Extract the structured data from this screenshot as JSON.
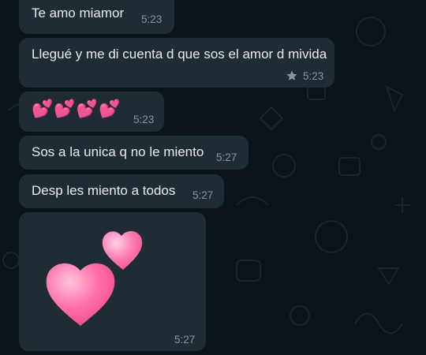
{
  "colors": {
    "wallpaper": "#0b141a",
    "bubble": "#1f2c33",
    "text": "#e9edef",
    "meta": "#8696a0",
    "heart": "#ff5f9a"
  },
  "messages": [
    {
      "text": "Te amo miamor",
      "time": "5:23",
      "starred": false
    },
    {
      "text": "Llegué y me di cuenta d que sos el amor d mivida",
      "time": "5:23",
      "starred": true
    },
    {
      "emoji": "💕💕💕💕",
      "time": "5:23",
      "starred": false
    },
    {
      "text": "Sos a la unica q no le miento",
      "time": "5:27",
      "starred": false
    },
    {
      "text": "Desp les miento a todos",
      "time": "5:27",
      "starred": false
    },
    {
      "sticker": "two-pink-hearts",
      "time": "5:27",
      "starred": false
    }
  ]
}
